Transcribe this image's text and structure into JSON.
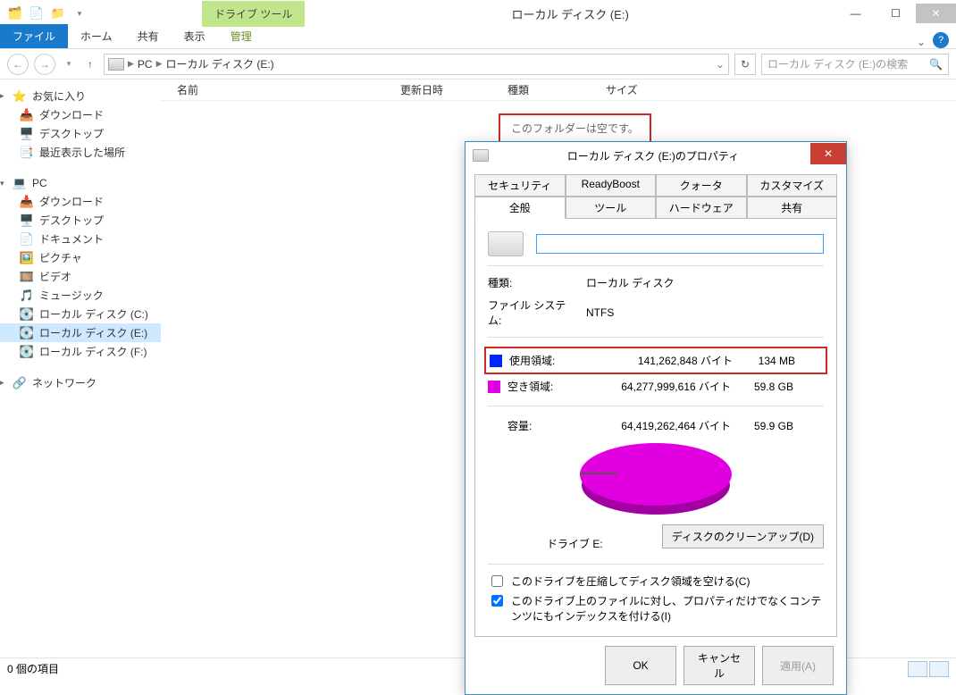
{
  "window": {
    "contextual_tool": "ドライブ ツール",
    "title": "ローカル ディスク (E:)"
  },
  "ribbon": {
    "file": "ファイル",
    "home": "ホーム",
    "share": "共有",
    "view": "表示",
    "manage": "管理"
  },
  "breadcrumb": {
    "pc": "PC",
    "drive": "ローカル ディスク (E:)"
  },
  "search": {
    "placeholder": "ローカル ディスク (E:)の検索"
  },
  "nav": {
    "favorites": {
      "title": "お気に入り",
      "downloads": "ダウンロード",
      "desktop": "デスクトップ",
      "recent": "最近表示した場所"
    },
    "pc": {
      "title": "PC",
      "downloads": "ダウンロード",
      "desktop": "デスクトップ",
      "documents": "ドキュメント",
      "pictures": "ピクチャ",
      "videos": "ビデオ",
      "music": "ミュージック",
      "local_c": "ローカル ディスク (C:)",
      "local_e": "ローカル ディスク (E:)",
      "local_f": "ローカル ディスク (F:)"
    },
    "network": "ネットワーク"
  },
  "columns": {
    "name": "名前",
    "date": "更新日時",
    "type": "種類",
    "size": "サイズ"
  },
  "empty_folder": "このフォルダーは空です。",
  "status": {
    "items": "0 個の項目"
  },
  "props": {
    "title": "ローカル ディスク (E:)のプロパティ",
    "tabs_top": {
      "security": "セキュリティ",
      "readyboost": "ReadyBoost",
      "quota": "クォータ",
      "customize": "カスタマイズ"
    },
    "tabs_bottom": {
      "general": "全般",
      "tools": "ツール",
      "hardware": "ハードウェア",
      "sharing": "共有"
    },
    "vol_value": "",
    "type_label": "種類:",
    "type_value": "ローカル ディスク",
    "fs_label": "ファイル システム:",
    "fs_value": "NTFS",
    "used_label": "使用領域:",
    "used_bytes": "141,262,848 バイト",
    "used_size": "134 MB",
    "free_label": "空き領域:",
    "free_bytes": "64,277,999,616 バイト",
    "free_size": "59.8 GB",
    "cap_label": "容量:",
    "cap_bytes": "64,419,262,464 バイト",
    "cap_size": "59.9 GB",
    "drive_label": "ドライブ E:",
    "cleanup": "ディスクのクリーンアップ(D)",
    "compress": "このドライブを圧縮してディスク領域を空ける(C)",
    "index": "このドライブ上のファイルに対し、プロパティだけでなくコンテンツにもインデックスを付ける(I)",
    "ok": "OK",
    "cancel": "キャンセル",
    "apply": "適用(A)"
  },
  "chart_data": {
    "type": "pie",
    "title": "ドライブ E:",
    "series": [
      {
        "name": "使用領域",
        "value_bytes": 141262848,
        "value_label": "134 MB",
        "color": "#0026ff"
      },
      {
        "name": "空き領域",
        "value_bytes": 64277999616,
        "value_label": "59.8 GB",
        "color": "#e000e0"
      }
    ],
    "total": {
      "name": "容量",
      "value_bytes": 64419262464,
      "value_label": "59.9 GB"
    }
  }
}
